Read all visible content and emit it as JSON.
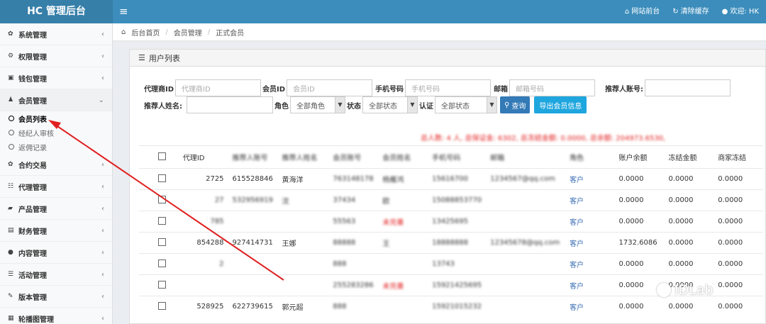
{
  "app": {
    "title": "HC 管理后台",
    "menu_toggle": "≡"
  },
  "topnav": {
    "site_front": "网站前台",
    "clear_cache": "清除缓存",
    "welcome": "欢迎: HK"
  },
  "sidebar": {
    "items": [
      {
        "label": "系统管理",
        "icon": "gear-icon"
      },
      {
        "label": "权限管理",
        "icon": "gears-icon"
      },
      {
        "label": "钱包管理",
        "icon": "wallet-icon"
      },
      {
        "label": "会员管理",
        "icon": "user-icon",
        "open": true
      },
      {
        "label": "合约交易",
        "icon": "gear-icon"
      },
      {
        "label": "代理管理",
        "icon": "sitemap-icon"
      },
      {
        "label": "产品管理",
        "icon": "truck-icon"
      },
      {
        "label": "财务管理",
        "icon": "money-icon"
      },
      {
        "label": "内容管理",
        "icon": "comments-icon"
      },
      {
        "label": "活动管理",
        "icon": "list-icon"
      },
      {
        "label": "版本管理",
        "icon": "wrench-icon"
      },
      {
        "label": "轮播图管理",
        "icon": "image-icon"
      }
    ],
    "sub_items": [
      {
        "label": "会员列表",
        "active": true
      },
      {
        "label": "经纪人审核"
      },
      {
        "label": "返佣记录"
      }
    ]
  },
  "breadcrumb": {
    "home": "后台首页",
    "level1": "会员管理",
    "level2": "正式会员"
  },
  "panel": {
    "title": "用户列表"
  },
  "filters": {
    "agent_id_label": "代理商ID",
    "agent_id_placeholder": "代理商ID",
    "member_id_label": "会员ID",
    "member_id_placeholder": "会员ID",
    "phone_label": "手机号码",
    "phone_placeholder": "手机号码",
    "email_label": "邮箱",
    "email_placeholder": "邮箱号码",
    "referrer_account_label": "推荐人账号:",
    "referrer_name_label": "推荐人姓名:",
    "role_label": "角色",
    "role_value": "全部角色",
    "status_label": "状态",
    "status_value": "全部状态",
    "auth_label": "认证",
    "auth_value": "全部状态",
    "search_button": "查询",
    "export_button": "导出会员信息"
  },
  "summary": {
    "text": "总人数: 4 人, 总保证金: 6302, 总冻结金额: 0.0000, 总余额: 204973.6530,"
  },
  "table": {
    "headers": [
      "",
      "代理ID",
      "推荐人账号",
      "推荐人姓名",
      "会员账号",
      "会员姓名",
      "手机号码",
      "邮箱",
      "角色",
      "账户余额",
      "冻结金额",
      "商家冻结"
    ],
    "rows": [
      [
        "",
        "2725",
        "615528846",
        "黄海洋",
        "763148178",
        "杨雁鸿",
        "15616700",
        "1234567@qq.com",
        "客户",
        "0.0000",
        "0.0000",
        "0.0000"
      ],
      [
        "",
        "27",
        "532956919",
        "沈",
        "37434",
        "欧",
        "15088853770",
        "",
        "客户",
        "0.0000",
        "0.0000",
        "0.0000"
      ],
      [
        "",
        "785",
        "",
        "",
        "55563",
        "未完善",
        "13425695",
        "",
        "客户",
        "0.0000",
        "0.0000",
        "0.0000"
      ],
      [
        "",
        "854288",
        "927414731",
        "王娜",
        "88888",
        "王",
        "18888888",
        "12345678@qq.com",
        "客户",
        "1732.6086",
        "0.0000",
        "0.0000"
      ],
      [
        "",
        "2",
        "",
        "",
        "888",
        "",
        "13743",
        "",
        "客户",
        "0.0000",
        "0.0000",
        "0.0000"
      ],
      [
        "",
        "",
        "",
        "",
        "255283286",
        "未完善",
        "15921425695",
        "",
        "客户",
        "0.0000",
        "0.0000",
        "0.0000"
      ],
      [
        "",
        "528925",
        "622739615",
        "郭元超",
        "888",
        "",
        "15921015232",
        "",
        "客户",
        "0.0000",
        "0.0000",
        "0.0000"
      ]
    ]
  },
  "watermark": {
    "text": "IDLab"
  }
}
